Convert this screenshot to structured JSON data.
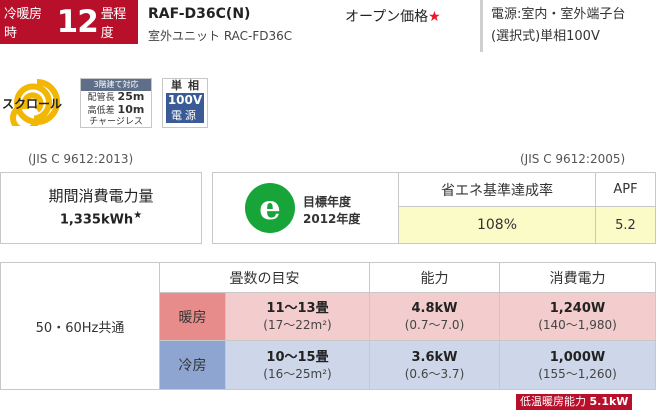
{
  "header": {
    "tatami_prefix": "冷暖房時",
    "tatami_number": "12",
    "tatami_suffix": "畳程度",
    "model": "RAF-D36C(N)",
    "outdoor_unit": "室外ユニット RAC-FD36C",
    "price": "オープン価格",
    "price_star": "★",
    "power_line1": "電源:室内・室外端子台",
    "power_line2": "(選択式)単相100V"
  },
  "badges": {
    "scroll_label": "スクロール",
    "pipe_header": "3階建て対応",
    "pipe_len_label": "配管長",
    "pipe_len_value": "25m",
    "pipe_height_label": "高低差",
    "pipe_height_value": "10m",
    "pipe_charge": "チャージレス",
    "phase_l1": "単相",
    "phase_l2": "100V",
    "phase_l3": "電源"
  },
  "jis": {
    "left": "(JIS C 9612:2013)",
    "right": "(JIS C 9612:2005)"
  },
  "annual": {
    "label": "期間消費電力量",
    "value": "1,335kWh",
    "star": "★"
  },
  "energy": {
    "logo_letter": "e",
    "target_line1": "目標年度",
    "target_line2": "2012年度",
    "header_rate": "省エネ基準達成率",
    "header_apf": "APF",
    "rate_value": "108%",
    "apf_value": "5.2"
  },
  "capacity": {
    "hz_label": "50・60Hz共通",
    "headers": [
      "畳数の目安",
      "能力",
      "消費電力"
    ],
    "heat": {
      "mode": "暖房",
      "tatami": "11〜13畳",
      "tatami_area": "(17〜22m²)",
      "capacity": "4.8kW",
      "capacity_range": "(0.7〜7.0)",
      "consumption": "1,240W",
      "consumption_range": "(140〜1,980)"
    },
    "cool": {
      "mode": "冷房",
      "tatami": "10〜15畳",
      "tatami_area": "(16〜25m²)",
      "capacity": "3.6kW",
      "capacity_range": "(0.6〜3.7)",
      "consumption": "1,000W",
      "consumption_range": "(155〜1,260)"
    }
  },
  "low_temp": {
    "label": "低温暖房能力",
    "value": "5.1kW"
  },
  "colors": {
    "brand_red": "#b8102b",
    "energy_green": "#17a53a",
    "heat_bg": "#f3cdcd",
    "cool_bg": "#cdd7e9",
    "highlight_yellow": "#fbfbc8"
  }
}
